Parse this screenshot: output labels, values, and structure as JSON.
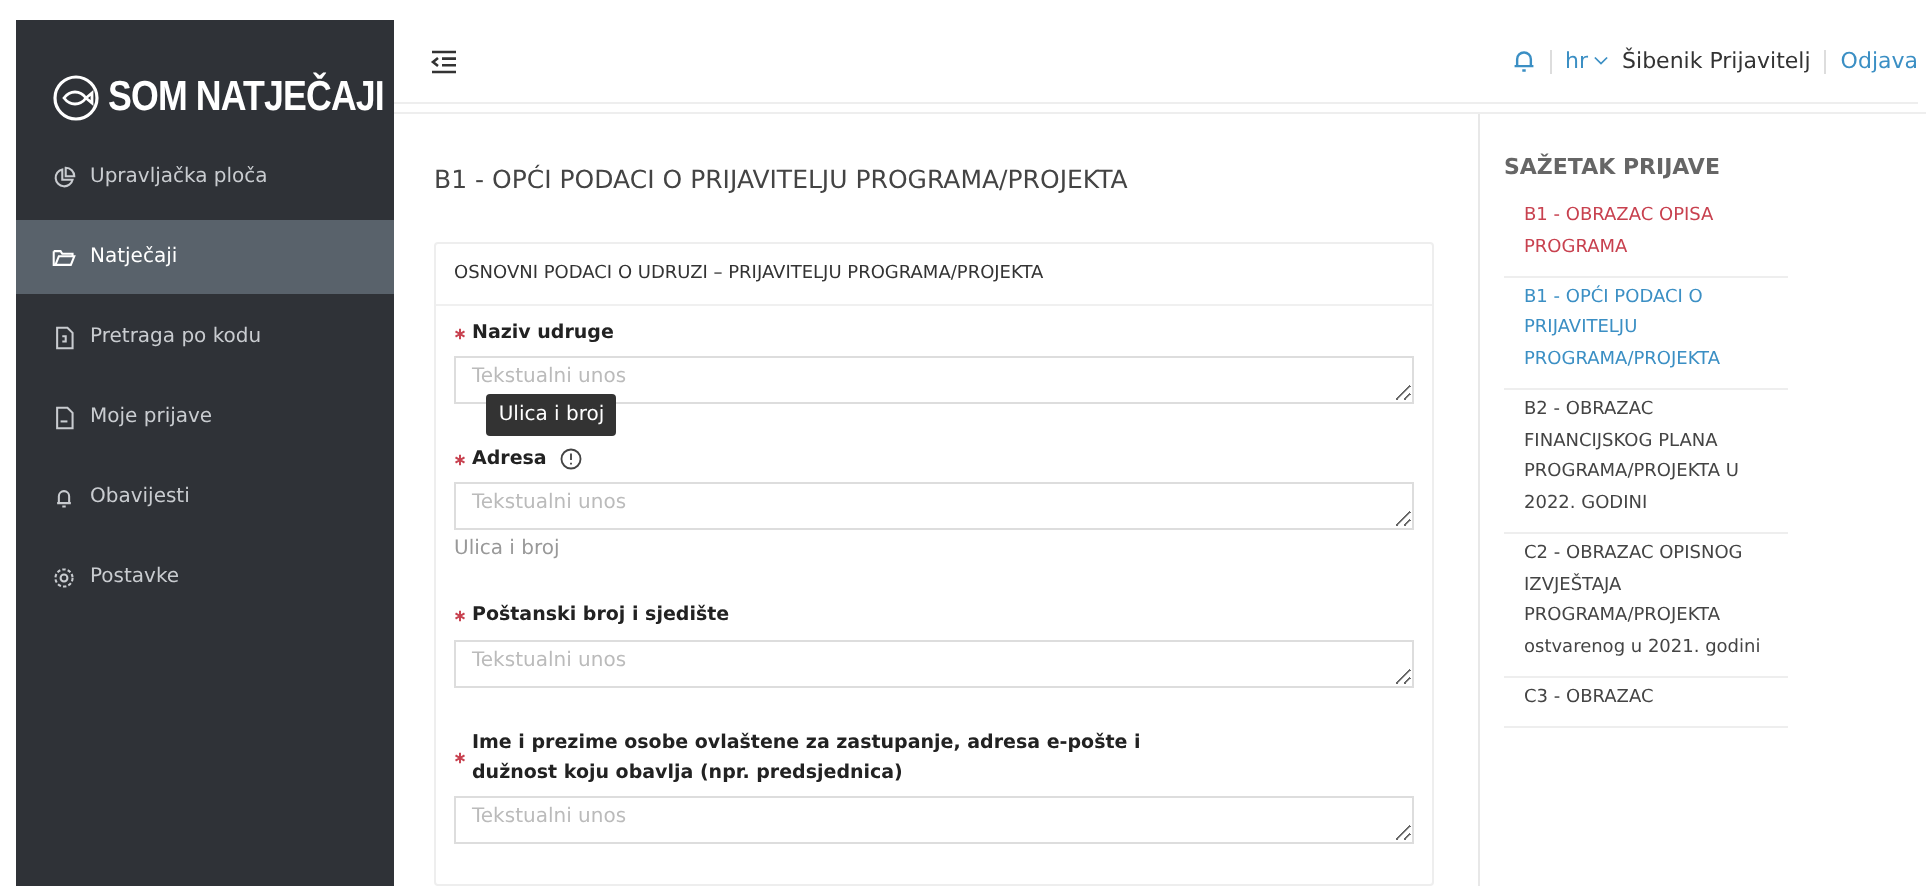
{
  "sidebar": {
    "logo": "SOM NATJEČAJI",
    "items": [
      {
        "label": "Upravljačka ploča",
        "selected": false
      },
      {
        "label": "Natječaji",
        "selected": true
      },
      {
        "label": "Pretraga po kodu",
        "selected": false
      },
      {
        "label": "Moje prijave",
        "selected": false
      },
      {
        "label": "Obavijesti",
        "selected": false
      },
      {
        "label": "Postavke",
        "selected": false
      }
    ]
  },
  "topbar": {
    "language": "hr",
    "user": "Šibenik Prijavitelj",
    "logout": "Odjava"
  },
  "page": {
    "title": "B1 - OPĆI PODACI O PRIJAVITELJU PROGRAMA/PROJEKTA",
    "card": {
      "title": "OSNOVNI PODACI O UDRUZI – PRIJAVITELJU PROGRAMA/PROJEKTA",
      "fields": [
        {
          "label": "Naziv udruge",
          "required": true,
          "placeholder": "Tekstualni unos"
        },
        {
          "label": "Adresa",
          "required": true,
          "placeholder": "Tekstualni unos",
          "info": true,
          "tooltip": "Ulica i broj",
          "help": "Ulica i broj"
        },
        {
          "label": "Poštanski broj i sjedište",
          "required": true,
          "placeholder": "Tekstualni unos"
        },
        {
          "label": "Ime i prezime osobe ovlaštene za zastupanje, adresa e-pošte i dužnost koju obavlja (npr. predsjednica)",
          "required": true,
          "placeholder": "Tekstualni unos"
        }
      ]
    }
  },
  "summary": {
    "title": "SAŽETAK PRIJAVE",
    "items": [
      {
        "label": "B1 - OBRAZAC OPISA PROGRAMA",
        "color": "#c8414f"
      },
      {
        "label": "B1 - OPĆI PODACI O PRIJAVITELJU PROGRAMA/PROJEKTA",
        "color": "#3b8fc4"
      },
      {
        "label": "B2 - OBRAZAC FINANCIJSKOG PLANA PROGRAMA/PROJEKTA U 2022. GODINI",
        "color": "#444444"
      },
      {
        "label": "C2 - OBRAZAC OPISNOG IZVJEŠTAJA PROGRAMA/PROJEKTA ostvarenog u 2021. godini",
        "color": "#444444"
      },
      {
        "label": "C3 - OBRAZAC",
        "color": "#444444"
      }
    ]
  }
}
